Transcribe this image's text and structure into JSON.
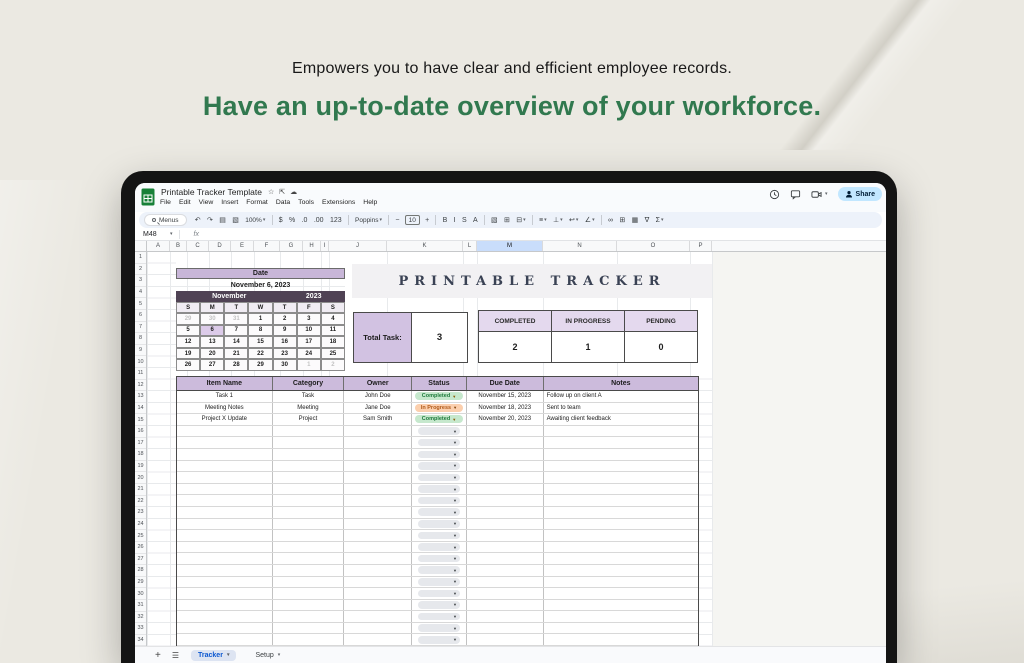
{
  "hero": {
    "subtitle": "Empowers you to have clear and efficient employee records.",
    "title": "Have an up-to-date overview of your workforce."
  },
  "colors": {
    "hero_title_green": "#31794f",
    "purple_header": "#c8b6d8",
    "purple_dark": "#4f4254",
    "purple_selected_day": "#dccbe9",
    "completed_pill": "#c6e8cd",
    "in_progress_pill": "#fbcfad",
    "share_blue": "#c2e7ff",
    "selected_column_blue": "#c9ddfb"
  },
  "sheets": {
    "doc_title": "Printable Tracker Template",
    "title_icons": [
      {
        "name": "star-icon",
        "glyph": "☆"
      },
      {
        "name": "move-to-folder-icon",
        "glyph": "⇱"
      },
      {
        "name": "cloud-status-icon",
        "glyph": "☁"
      }
    ],
    "menus": [
      "File",
      "Edit",
      "View",
      "Insert",
      "Format",
      "Data",
      "Tools",
      "Extensions",
      "Help"
    ],
    "header_right": {
      "share_label": "Share"
    },
    "toolbar_items": [
      {
        "kind": "search",
        "name": "menus-search",
        "label": "Menus"
      },
      {
        "kind": "icon",
        "name": "undo-icon",
        "glyph": "↶"
      },
      {
        "kind": "icon",
        "name": "redo-icon",
        "glyph": "↷"
      },
      {
        "kind": "icon",
        "name": "print-icon",
        "glyph": "▤"
      },
      {
        "kind": "icon",
        "name": "paint-format-icon",
        "glyph": "▧"
      },
      {
        "kind": "dropdown",
        "name": "zoom-select",
        "label": "100%"
      },
      {
        "kind": "sep"
      },
      {
        "kind": "icon",
        "name": "format-currency-icon",
        "glyph": "$"
      },
      {
        "kind": "icon",
        "name": "format-percent-icon",
        "glyph": "%"
      },
      {
        "kind": "icon",
        "name": "decrease-decimals-icon",
        "glyph": ".0"
      },
      {
        "kind": "icon",
        "name": "increase-decimals-icon",
        "glyph": ".00"
      },
      {
        "kind": "icon",
        "name": "more-formats-icon",
        "glyph": "123"
      },
      {
        "kind": "sep"
      },
      {
        "kind": "dropdown",
        "name": "font-select",
        "label": "Poppins"
      },
      {
        "kind": "sep"
      },
      {
        "kind": "icon",
        "name": "decrease-font-size-icon",
        "glyph": "−"
      },
      {
        "kind": "box",
        "name": "font-size-input",
        "label": "10"
      },
      {
        "kind": "icon",
        "name": "increase-font-size-icon",
        "glyph": "+"
      },
      {
        "kind": "sep"
      },
      {
        "kind": "icon",
        "name": "bold-icon",
        "glyph": "B"
      },
      {
        "kind": "icon",
        "name": "italic-icon",
        "glyph": "I"
      },
      {
        "kind": "icon",
        "name": "strikethrough-icon",
        "glyph": "S"
      },
      {
        "kind": "icon",
        "name": "text-color-icon",
        "glyph": "A"
      },
      {
        "kind": "sep"
      },
      {
        "kind": "icon",
        "name": "fill-color-icon",
        "glyph": "▧"
      },
      {
        "kind": "icon",
        "name": "borders-icon",
        "glyph": "⊞"
      },
      {
        "kind": "dropicon",
        "name": "merge-cells-icon",
        "glyph": "⊟"
      },
      {
        "kind": "sep"
      },
      {
        "kind": "dropicon",
        "name": "horizontal-align-icon",
        "glyph": "≡"
      },
      {
        "kind": "dropicon",
        "name": "vertical-align-icon",
        "glyph": "⊥"
      },
      {
        "kind": "dropicon",
        "name": "text-wrap-icon",
        "glyph": "↩"
      },
      {
        "kind": "dropicon",
        "name": "text-rotation-icon",
        "glyph": "∠"
      },
      {
        "kind": "sep"
      },
      {
        "kind": "icon",
        "name": "insert-link-icon",
        "glyph": "∞"
      },
      {
        "kind": "icon",
        "name": "insert-comment-icon",
        "glyph": "⊞"
      },
      {
        "kind": "icon",
        "name": "insert-chart-icon",
        "glyph": "▦"
      },
      {
        "kind": "icon",
        "name": "create-filter-icon",
        "glyph": "∇"
      },
      {
        "kind": "dropicon",
        "name": "functions-icon",
        "glyph": "Σ"
      }
    ],
    "name_box": "M48",
    "fx_label": "fx",
    "columns": [
      "A",
      "B",
      "C",
      "D",
      "E",
      "F",
      "G",
      "H",
      "I",
      "J",
      "K",
      "L",
      "M",
      "N",
      "O",
      "P"
    ],
    "selected_column": "M",
    "row_count": 34,
    "tabs": [
      {
        "label": "Tracker",
        "active": true
      },
      {
        "label": "Setup",
        "active": false
      }
    ]
  },
  "tracker": {
    "banner_title": "PRINTABLE TRACKER",
    "date_label": "Date",
    "date_value": "November 6, 2023",
    "month": "November",
    "year": "2023",
    "weekdays": [
      "S",
      "M",
      "T",
      "W",
      "T",
      "F",
      "S"
    ],
    "weeks": [
      [
        {
          "d": "29",
          "muted": true
        },
        {
          "d": "30",
          "muted": true
        },
        {
          "d": "31",
          "muted": true
        },
        {
          "d": "1"
        },
        {
          "d": "2"
        },
        {
          "d": "3"
        },
        {
          "d": "4"
        }
      ],
      [
        {
          "d": "5"
        },
        {
          "d": "6",
          "selected": true
        },
        {
          "d": "7"
        },
        {
          "d": "8"
        },
        {
          "d": "9"
        },
        {
          "d": "10"
        },
        {
          "d": "11"
        }
      ],
      [
        {
          "d": "12"
        },
        {
          "d": "13"
        },
        {
          "d": "14"
        },
        {
          "d": "15"
        },
        {
          "d": "16"
        },
        {
          "d": "17"
        },
        {
          "d": "18"
        }
      ],
      [
        {
          "d": "19"
        },
        {
          "d": "20"
        },
        {
          "d": "21"
        },
        {
          "d": "22"
        },
        {
          "d": "23"
        },
        {
          "d": "24"
        },
        {
          "d": "25"
        }
      ],
      [
        {
          "d": "26"
        },
        {
          "d": "27"
        },
        {
          "d": "28"
        },
        {
          "d": "29"
        },
        {
          "d": "30"
        },
        {
          "d": "1",
          "muted": true
        },
        {
          "d": "2",
          "muted": true
        }
      ]
    ],
    "total_task_label": "Total Task:",
    "total_task_value": "3",
    "summary": [
      {
        "label": "COMPLETED",
        "value": "2"
      },
      {
        "label": "IN PROGRESS",
        "value": "1"
      },
      {
        "label": "PENDING",
        "value": "0"
      }
    ],
    "table": {
      "headers": [
        "Item Name",
        "Category",
        "Owner",
        "Status",
        "Due Date",
        "Notes"
      ],
      "rows": [
        {
          "item": "Task 1",
          "category": "Task",
          "owner": "John Doe",
          "status": "Completed",
          "status_type": "completed",
          "due": "November 15, 2023",
          "notes": "Follow up on client A"
        },
        {
          "item": "Meeting Notes",
          "category": "Meeting",
          "owner": "Jane Doe",
          "status": "In Progress",
          "status_type": "in-progress",
          "due": "November 18, 2023",
          "notes": "Sent to team"
        },
        {
          "item": "Project X Update",
          "category": "Project",
          "owner": "Sam Smith",
          "status": "Completed",
          "status_type": "completed",
          "due": "November 20, 2023",
          "notes": "Awaiting client feedback"
        }
      ],
      "empty_row_count": 19
    }
  }
}
